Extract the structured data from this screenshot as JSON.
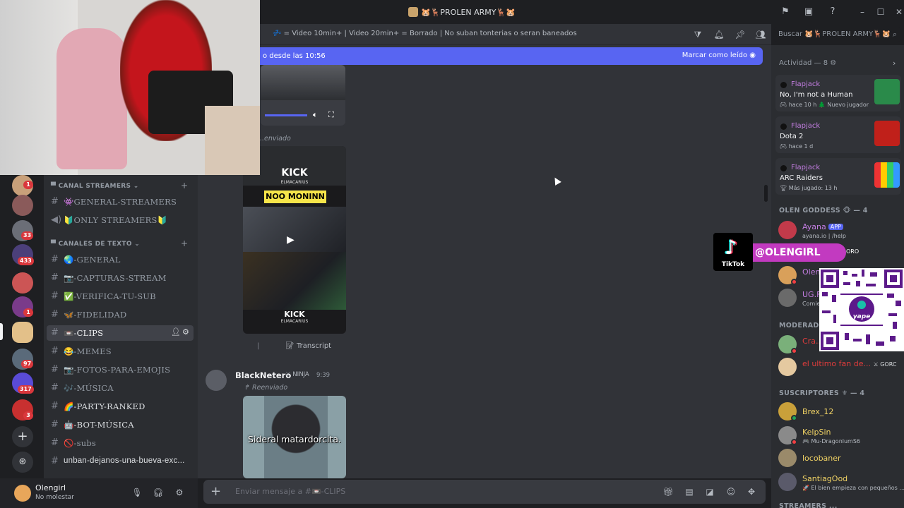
{
  "window": {
    "title": "🐹🦌PROLEN ARMY🦌🐹",
    "controls": [
      "minimize",
      "maximize",
      "close"
    ]
  },
  "header": {
    "topic": "💤 = Video 10min+ | Video 20min+ = Borrado | No suban tonterias o seran baneados",
    "search_placeholder": "Buscar 🐹🦌PROLEN ARMY🦌🐹"
  },
  "new_messages_bar": {
    "left_text": "o desde las 10:56",
    "right_text": "Marcar como leído"
  },
  "servers": [
    {
      "badge": "1"
    },
    {
      "badge": ""
    },
    {
      "badge": "33"
    },
    {
      "badge": "433"
    },
    {
      "badge": ""
    },
    {
      "badge": "1"
    },
    {
      "badge": ""
    },
    {
      "badge": "97"
    },
    {
      "badge": "317"
    },
    {
      "badge": "3"
    }
  ],
  "channel_sidebar": {
    "categories": [
      {
        "name": "CANAL STREAMERS",
        "channels": [
          {
            "name": "👾GENERAL-STREAMERS",
            "icon": "#"
          },
          {
            "name": "🔰ONLY STREAMERS🔰",
            "icon": "speaker"
          }
        ]
      },
      {
        "name": "CANALES DE TEXTO",
        "channels": [
          {
            "name": "🌏-GENERAL"
          },
          {
            "name": "📷-CAPTURAS-STREAM"
          },
          {
            "name": "✅-VERIFICA-TU-SUB"
          },
          {
            "name": "🦋-FIDELIDAD"
          },
          {
            "name": "📼-CLIPS",
            "active": true
          },
          {
            "name": "😂-MEMES"
          },
          {
            "name": "📷-FOTOS-PARA-EMOJIS"
          },
          {
            "name": "🎶-MÚSICA"
          },
          {
            "name": "🌈-PARTY-RANKED"
          },
          {
            "name": "🤖-BOT-MÚSICA"
          },
          {
            "name": "🚫-subs"
          },
          {
            "name": "unban-dejanos-una-bueva-exc..."
          }
        ]
      }
    ]
  },
  "user_panel": {
    "name": "Olengirl",
    "status": "No molestar"
  },
  "messages": {
    "forwarded_label_1": "...enviado",
    "thumb_1_text_top": "KICK",
    "thumb_1_text_sub": "ELMACARIUS",
    "thumb_1_caption": "NOO MONINN",
    "thumb_1_text_bottom": "KICK",
    "thumb_1_text_bottom_sub": "ELMACARIUS",
    "transcript_label": "Transcript",
    "author": "BlackNetero",
    "author_tag": "NINJA",
    "time": "9:39",
    "forwarded_label_2": "Reenviado",
    "thumb_2_caption": "Sideral matardorcita."
  },
  "input": {
    "placeholder": "Enviar mensaje a #📼-CLIPS"
  },
  "member_list": {
    "activity_header": "Actividad — 8",
    "activities": [
      {
        "user": "Flapjack",
        "game": "No, I'm not a Human",
        "meta": "hace 10 h  🌲 Nuevo jugador",
        "thumb_color": "#2a8a4a"
      },
      {
        "user": "Flapjack",
        "game": "Dota 2",
        "meta": "hace 1 d",
        "thumb_color": "#c0201a"
      },
      {
        "user": "Flapjack",
        "game": "ARC Raiders",
        "meta": "Más jugado: 13 h",
        "thumb_color": "#222222"
      }
    ],
    "groups": [
      {
        "name": "OLEN GODDESS 🐵 — 4",
        "members": [
          {
            "name": "Ayana",
            "app": "APP",
            "sub": "ayana.io | /help",
            "color": "#c27de0"
          },
          {
            "name": "Olen...",
            "sub": "",
            "color": "#c27de0"
          },
          {
            "name": "UG.F...",
            "sub": "Comie...",
            "color": "#c27de0"
          }
        ]
      },
      {
        "name": "MODERADO...",
        "members": [
          {
            "name": "Cra...",
            "sub": "",
            "color": "#e03c3c"
          },
          {
            "name": "el ultimo fan de...",
            "tag": "GORC",
            "sub": "",
            "color": "#e03c3c"
          }
        ]
      },
      {
        "name": "SUSCRIPTORES ⚜ — 4",
        "members": [
          {
            "name": "Brex_12",
            "sub": "",
            "color": "#f0d264"
          },
          {
            "name": "KelpSin",
            "sub": "🎮 Mu-DragonlumS6",
            "color": "#f0d264"
          },
          {
            "name": "locobaner",
            "sub": "",
            "color": "#f0d264"
          },
          {
            "name": "SantiagOod",
            "sub": "🚀 El bien empieza con pequeños ...",
            "color": "#f0d264"
          }
        ]
      }
    ],
    "next_group_partial": "STREAMERS ..."
  },
  "overlays": {
    "tiktok_label": "TikTok",
    "tiktok_handle": "@OLENGIRL",
    "gorc_tag": "ORO",
    "qr_label": "yape"
  }
}
